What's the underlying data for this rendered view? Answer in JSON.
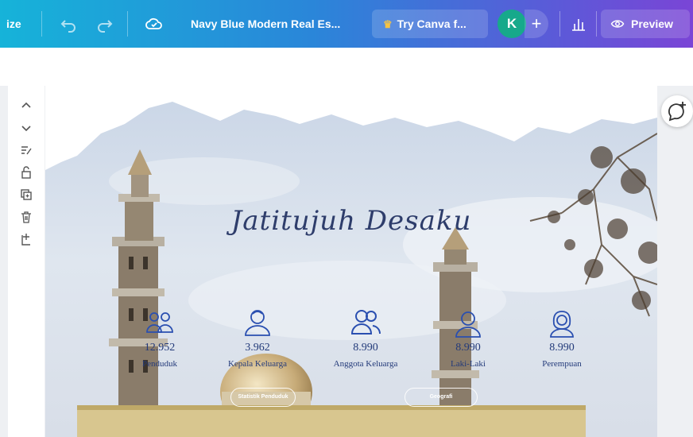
{
  "topbar": {
    "resize_label": "ize",
    "doc_title": "Navy Blue Modern Real Es...",
    "try_canva_label": "Try Canva f...",
    "avatar_initial": "K",
    "add_label": "+",
    "preview_label": "Preview",
    "accent_start": "#16b3d9",
    "accent_end": "#7a45d6"
  },
  "side_tools": [
    "chevron-up-icon",
    "chevron-down-icon",
    "notes-icon",
    "lock-icon",
    "duplicate-icon",
    "trash-icon",
    "add-page-icon"
  ],
  "design": {
    "title": "Jatitujuh Desaku",
    "stats": [
      {
        "icon": "group-icon",
        "value": "12.952",
        "label": "Penduduk"
      },
      {
        "icon": "person-icon",
        "value": "3.962",
        "label": "Kepala Keluarga"
      },
      {
        "icon": "family-icon",
        "value": "8.990",
        "label": "Anggota Keluarga"
      },
      {
        "icon": "male-icon",
        "value": "8.990",
        "label": "Laki-Laki"
      },
      {
        "icon": "female-icon",
        "value": "8.990",
        "label": "Perempuan"
      }
    ],
    "buttons": [
      "Statistik Penduduk",
      "Geografi"
    ]
  }
}
